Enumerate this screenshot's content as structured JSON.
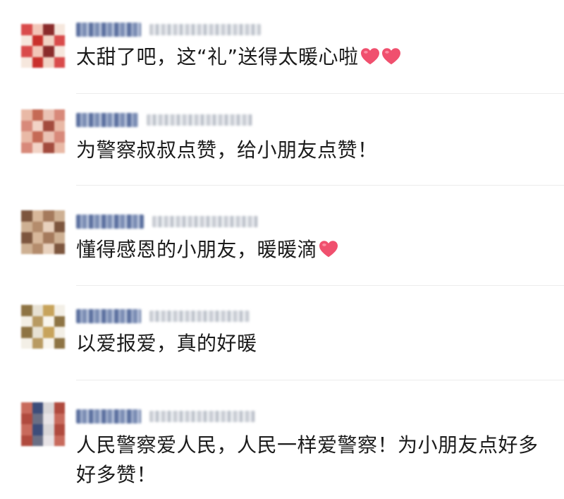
{
  "comments": [
    {
      "text": "太甜了吧，这“礼”送得太暖心啦",
      "hearts": 2,
      "avatar": [
        "#d94b4b",
        "#f1d3c5",
        "#c9302c",
        "#f6e7dd",
        "#8a2b2b",
        "#f2c6b8"
      ]
    },
    {
      "text": "为警察叔叔点赞，给小朋友点赞！",
      "hearts": 0,
      "avatar": [
        "#c56a55",
        "#e9b9a6",
        "#a34b3e",
        "#f2d3c6",
        "#d8897a",
        "#eac2b4"
      ]
    },
    {
      "text": "懂得感恩的小朋友，暖暖滴",
      "hearts": 1,
      "avatar": [
        "#a57a5c",
        "#d7b79a",
        "#7d563e",
        "#e8d1bd",
        "#b48c6c",
        "#ceb093"
      ]
    },
    {
      "text": "以爱报爱，真的好暖",
      "hearts": 0,
      "avatar": [
        "#f3efe6",
        "#c7a35b",
        "#e7e1d3",
        "#8e7444",
        "#f8f5ee",
        "#b89a62"
      ]
    },
    {
      "text": "人民警察爱人民，人民一样爱警察！为小朋友点好多好多赞！",
      "hearts": 0,
      "avatar": [
        "#6a6f85",
        "#b04a3e",
        "#d9d6d8",
        "#3d4d7a",
        "#c86a5c",
        "#e7e3e6"
      ]
    }
  ],
  "colors": {
    "text": "#1b1b1b",
    "nickname": "#5a6f9e",
    "timestamp": "#c7cbd2",
    "divider": "#ececec",
    "heart": "#f0506e"
  },
  "icons": {
    "heart": "heart-icon"
  }
}
